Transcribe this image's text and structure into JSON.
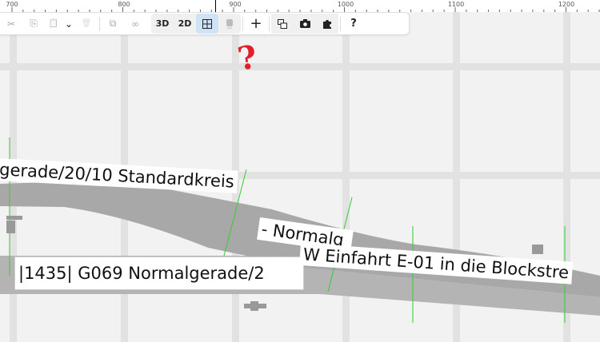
{
  "ruler": {
    "labels": [
      "700",
      "800",
      "900",
      "1000",
      "1100",
      "1200"
    ]
  },
  "toolbar": {
    "buttons": [
      {
        "name": "cut-button",
        "icon": "scissors-icon",
        "glyph": "✂",
        "disabled": true
      },
      {
        "name": "copy-button",
        "icon": "copy-icon",
        "glyph": "⎘",
        "disabled": true
      },
      {
        "name": "paste-button",
        "icon": "paste-icon",
        "glyph": "📋",
        "disabled": true
      },
      {
        "name": "paste-menu-button",
        "icon": "chevron-down-icon",
        "glyph": "⌄",
        "disabled": false
      },
      {
        "name": "delete-button",
        "icon": "trash-icon",
        "glyph": "🗑",
        "disabled": true
      },
      {
        "name": "group-button",
        "icon": "group-icon",
        "glyph": "⧉",
        "disabled": true
      },
      {
        "name": "link-button",
        "icon": "link-icon",
        "glyph": "∞",
        "disabled": true
      }
    ],
    "view_3d": "3D",
    "view_2d": "2D",
    "grid_icon": "grid-icon",
    "train_icon": "train-icon",
    "add_glyph": "+",
    "help_glyph": "?"
  },
  "annotation": "?",
  "colors": {
    "accent": "#cfe3f7",
    "annotation": "#e0202a",
    "track": "#b4b4b4",
    "marker": "#33cc33"
  },
  "labels": [
    {
      "text": "gerade/20/10 Standardkreis"
    },
    {
      "text": "- Normalg"
    },
    {
      "text": "|1435| G069 Normalgerade/2"
    },
    {
      "text": "W Einfahrt E-01 in die Blockstre"
    }
  ]
}
